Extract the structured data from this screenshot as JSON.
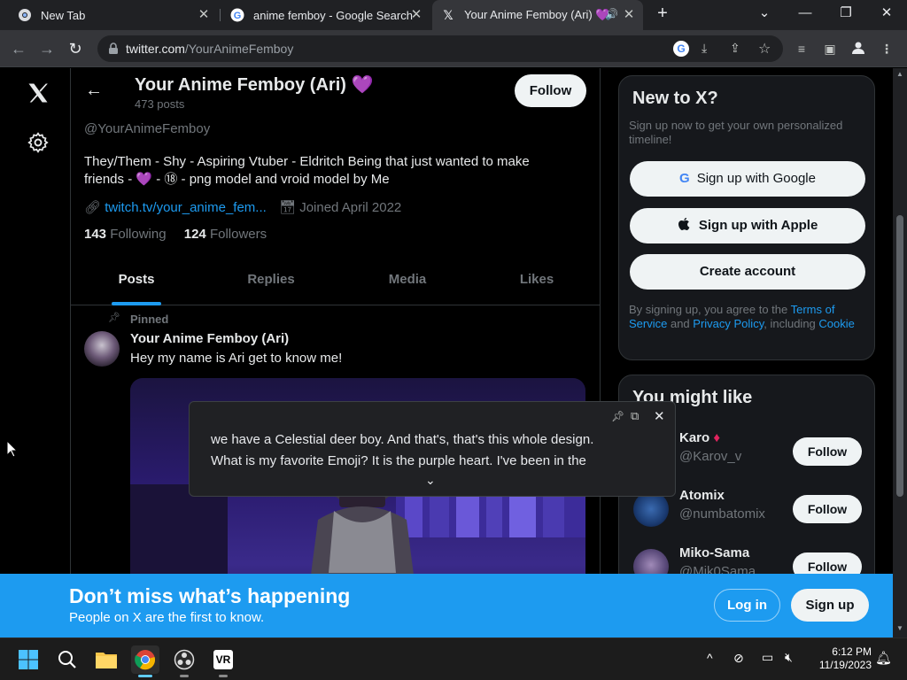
{
  "browser": {
    "tabs": [
      {
        "title": "New Tab",
        "active": false
      },
      {
        "title": "anime femboy - Google Search",
        "active": false
      },
      {
        "title": "Your Anime Femboy (Ari) 💜",
        "active": true
      }
    ],
    "url_host": "twitter.com",
    "url_path": "/YourAnimeFemboy",
    "colors": {
      "frame": "#202124",
      "toolbar": "#35363a"
    }
  },
  "profile": {
    "name": "Your Anime Femboy (Ari) 💜",
    "post_count": "473 posts",
    "handle": "@YourAnimeFemboy",
    "follow_label": "Follow",
    "bio_line1": "They/Them - Shy - Aspiring Vtuber - Eldritch Being that just wanted to make",
    "bio_line2": "friends - 💜 - ⑱ - png model and vroid model by Me",
    "link": "twitch.tv/your_anime_fem...",
    "joined": "Joined April 2022",
    "following_count": "143",
    "following_label": "Following",
    "followers_count": "124",
    "followers_label": "Followers"
  },
  "profile_tabs": [
    "Posts",
    "Replies",
    "Media",
    "Likes"
  ],
  "pinned_post": {
    "pinned_label": "Pinned",
    "author": "Your Anime Femboy (Ari)",
    "text": "Hey my name is Ari get to know me!"
  },
  "caption": {
    "line1": "we have a Celestial deer boy. And that's, that's this whole design.",
    "line2": "What is my favorite Emoji? It is the purple heart. I've been in the"
  },
  "sidebar": {
    "new_title": "New to X?",
    "new_sub": "Sign up now to get your own personalized timeline!",
    "google_btn": "Sign up with Google",
    "apple_btn": "Sign up with Apple",
    "create_btn": "Create account",
    "terms_pre": "By signing up, you agree to the ",
    "terms_link": "Terms of Service",
    "terms_mid": " and ",
    "privacy_link": "Privacy Policy",
    "terms_post": ", including ",
    "cookie_link": "Cookie",
    "might_like": "You might like",
    "suggestions": [
      {
        "name": "Karo",
        "handle": "@Karov_v",
        "follow": "Follow"
      },
      {
        "name": "Atomix",
        "handle": "@numbatomix",
        "follow": "Follow"
      },
      {
        "name": "Miko-Sama",
        "handle": "@Mik0Sama",
        "follow": "Follow"
      }
    ]
  },
  "banner": {
    "title": "Don’t miss what’s happening",
    "sub": "People on X are the first to know.",
    "login": "Log in",
    "signup": "Sign up",
    "color": "#1d9bf0"
  },
  "taskbar": {
    "time": "6:12 PM",
    "date": "11/19/2023"
  }
}
